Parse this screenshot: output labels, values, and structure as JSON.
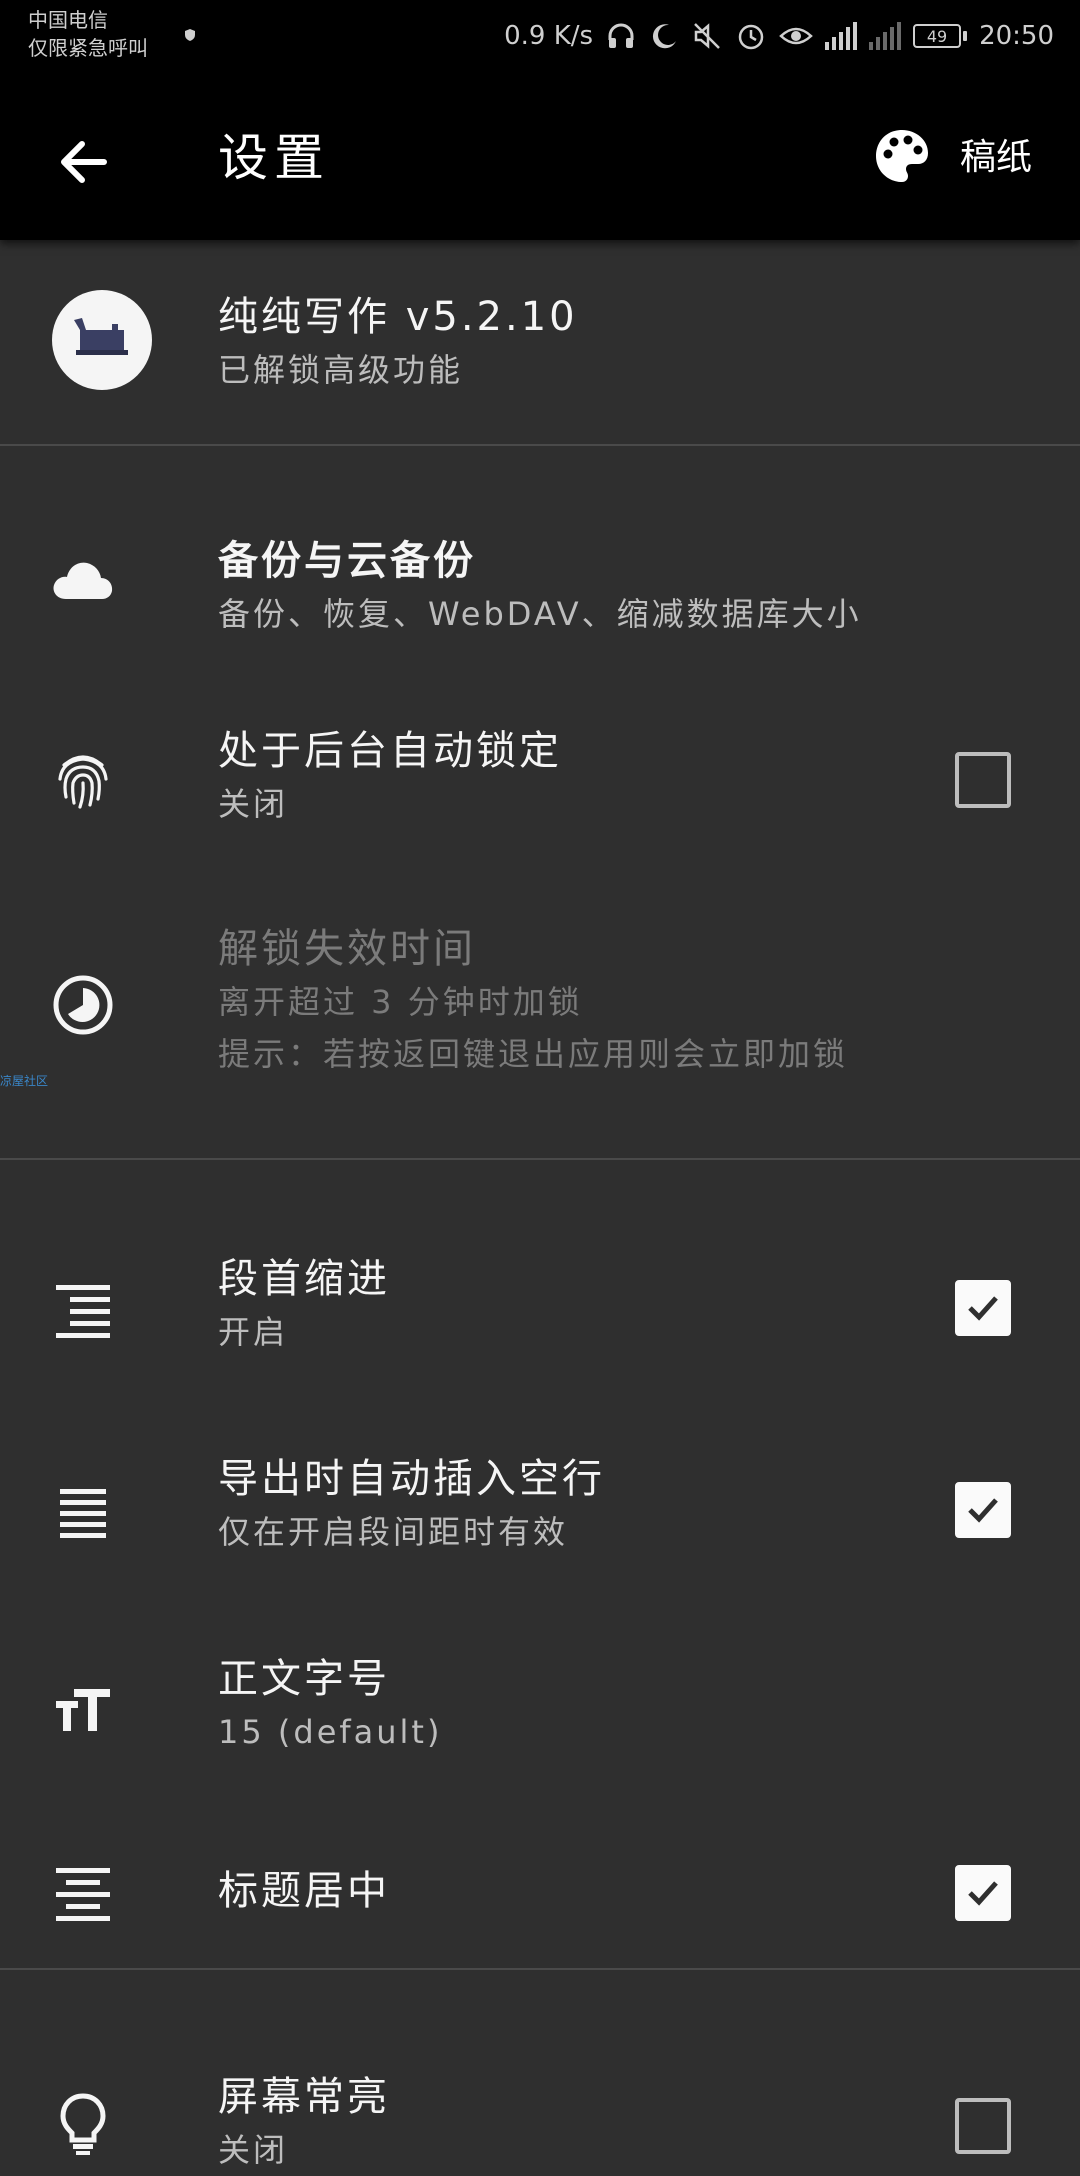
{
  "status_bar": {
    "carrier_line1": "中国电信",
    "carrier_line2": "仅限紧急呼叫",
    "net_speed": "0.9 K/s",
    "battery": "49",
    "time": "20:50"
  },
  "app_bar": {
    "title": "设置",
    "draft_label": "稿纸"
  },
  "about": {
    "title": "纯纯写作 v5.2.10",
    "subtitle": "已解锁高级功能"
  },
  "settings": [
    {
      "id": "backup",
      "icon": "cloud-icon",
      "title": "备份与云备份",
      "subtitle": "备份、恢复、WebDAV、缩减数据库大小",
      "bold": true
    },
    {
      "id": "autolock",
      "icon": "fingerprint-icon",
      "title": "处于后台自动锁定",
      "subtitle": "关闭",
      "checkbox": false
    },
    {
      "id": "unlock-timeout",
      "icon": "timer-icon",
      "title": "解锁失效时间",
      "subtitle": "离开超过 3 分钟时加锁",
      "subtitle2": "提示：若按返回键退出应用则会立即加锁",
      "disabled": true
    },
    {
      "id": "indent",
      "icon": "indent-icon",
      "title": "段首缩进",
      "subtitle": "开启",
      "checkbox": true
    },
    {
      "id": "blank-line",
      "icon": "lines-icon",
      "title": "导出时自动插入空行",
      "subtitle": "仅在开启段间距时有效",
      "checkbox": true
    },
    {
      "id": "font-size",
      "icon": "text-size-icon",
      "title": "正文字号",
      "subtitle": "15 (default)"
    },
    {
      "id": "center-title",
      "icon": "align-center-icon",
      "title": "标题居中",
      "checkbox": true
    },
    {
      "id": "screen-on",
      "icon": "lightbulb-icon",
      "title": "屏幕常亮",
      "subtitle": "关闭",
      "checkbox": false
    }
  ],
  "watermark": "凉屋社区"
}
